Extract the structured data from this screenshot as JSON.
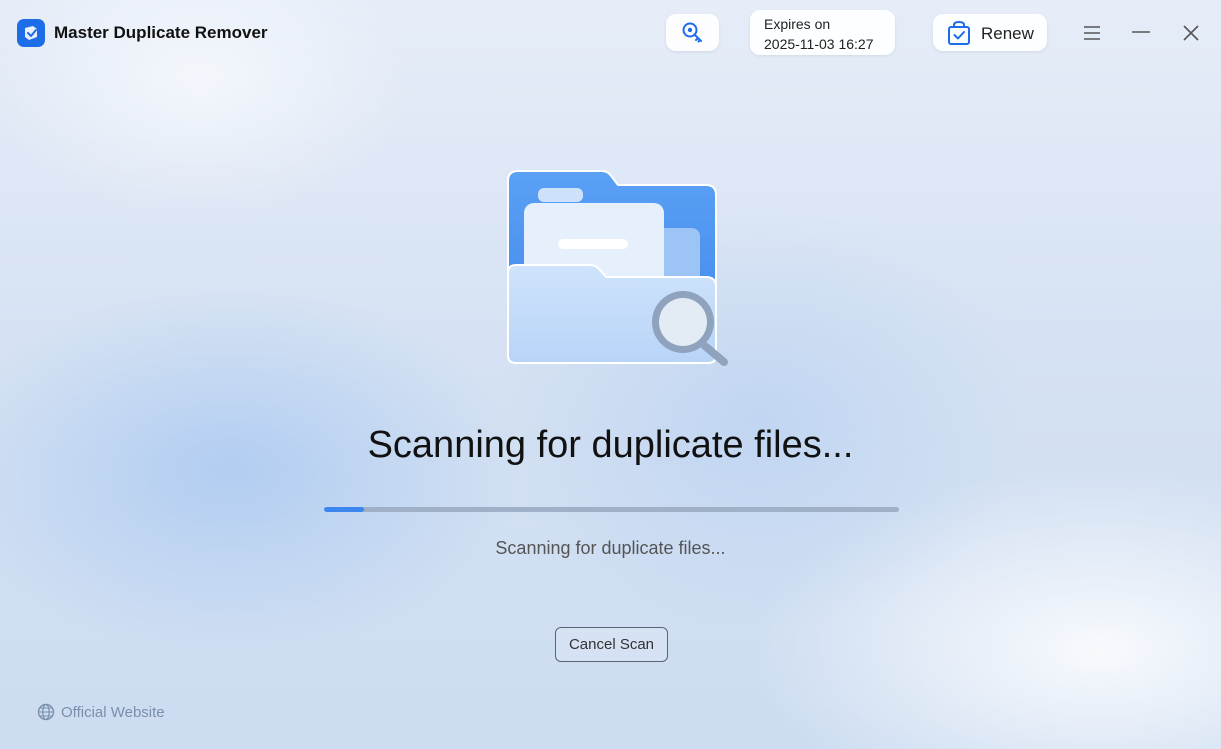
{
  "app": {
    "title": "Master Duplicate Remover"
  },
  "header": {
    "key_icon": "key-search-icon",
    "expiry_line1": "Expires on",
    "expiry_line2": "2025-11-03 16:27",
    "renew_label": "Renew",
    "renew_icon": "shopping-bag-check-icon",
    "menu_icon": "hamburger-menu-icon",
    "minimize_icon": "minimize-icon",
    "close_icon": "close-icon"
  },
  "main": {
    "illustration": "folder-search-icon",
    "heading": "Scanning for duplicate files...",
    "progress_fraction": 0.07,
    "subtext": "Scanning for duplicate files...",
    "cancel_label": "Cancel Scan"
  },
  "footer": {
    "website_label": "Official Website",
    "website_icon": "globe-icon"
  },
  "colors": {
    "accent": "#1d6ce8",
    "progress_fill": "#3d86f0",
    "progress_track": "#9fb0c7"
  }
}
